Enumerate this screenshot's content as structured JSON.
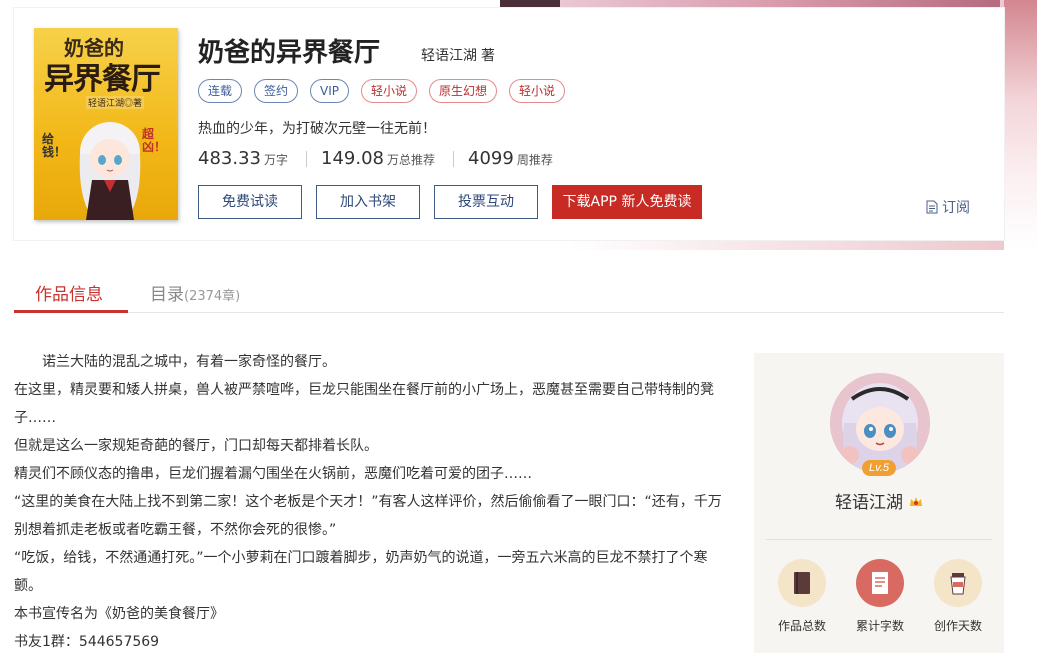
{
  "book": {
    "title": "奶爸的异界餐厅",
    "author": "轻语江湖",
    "author_suffix": "著",
    "cover_title_top": "奶爸的",
    "cover_title_main": "异界餐厅",
    "cover_author": "轻语江湖◎著",
    "cover_left": "给钱！",
    "cover_right": "超凶！",
    "tags": [
      {
        "label": "连载",
        "style": "blue"
      },
      {
        "label": "签约",
        "style": "blue"
      },
      {
        "label": "VIP",
        "style": "blue"
      },
      {
        "label": "轻小说",
        "style": "red"
      },
      {
        "label": "原生幻想",
        "style": "red"
      },
      {
        "label": "轻小说",
        "style": "red"
      }
    ],
    "slogan": "热血的少年，为打破次元壁一往无前！",
    "stats": [
      {
        "value": "483.33",
        "unit": "万字"
      },
      {
        "value": "149.08",
        "unit": "万总推荐"
      },
      {
        "value": "4099",
        "unit": "周推荐"
      }
    ]
  },
  "actions": {
    "free_read": "免费试读",
    "add_shelf": "加入书架",
    "vote": "投票互动",
    "download": "下载APP 新人免费读",
    "subscribe": "订阅"
  },
  "tabs": {
    "info": "作品信息",
    "catalog": "目录",
    "catalog_count": "(2374章)"
  },
  "intro": [
    "诺兰大陆的混乱之城中，有着一家奇怪的餐厅。",
    "在这里，精灵要和矮人拼桌，兽人被严禁喧哗，巨龙只能围坐在餐厅前的小广场上，恶魔甚至需要自己带特制的凳子……",
    "但就是这么一家规矩奇葩的餐厅，门口却每天都排着长队。",
    "精灵们不顾仪态的撸串，巨龙们握着漏勺围坐在火锅前，恶魔们吃着可爱的团子……",
    "“这里的美食在大陆上找不到第二家！这个老板是个天才！”有客人这样评价，然后偷偷看了一眼门口：“还有，千万别想着抓走老板或者吃霸王餐，不然你会死的很惨。”",
    "“吃饭，给钱，不然通通打死。”一个小萝莉在门口踱着脚步，奶声奶气的说道，一旁五六米高的巨龙不禁打了个寒颤。",
    "本书宣传名为《奶爸的美食餐厅》",
    "书友1群：544657569"
  ],
  "author_panel": {
    "name": "轻语江湖",
    "level": "Lv.5",
    "stats": [
      {
        "label": "作品总数",
        "icon": "book-icon",
        "color": "#f4e5c8"
      },
      {
        "label": "累计字数",
        "icon": "document-icon",
        "color": "#d96a62"
      },
      {
        "label": "创作天数",
        "icon": "coffee-icon",
        "color": "#f4e5c8"
      }
    ]
  }
}
